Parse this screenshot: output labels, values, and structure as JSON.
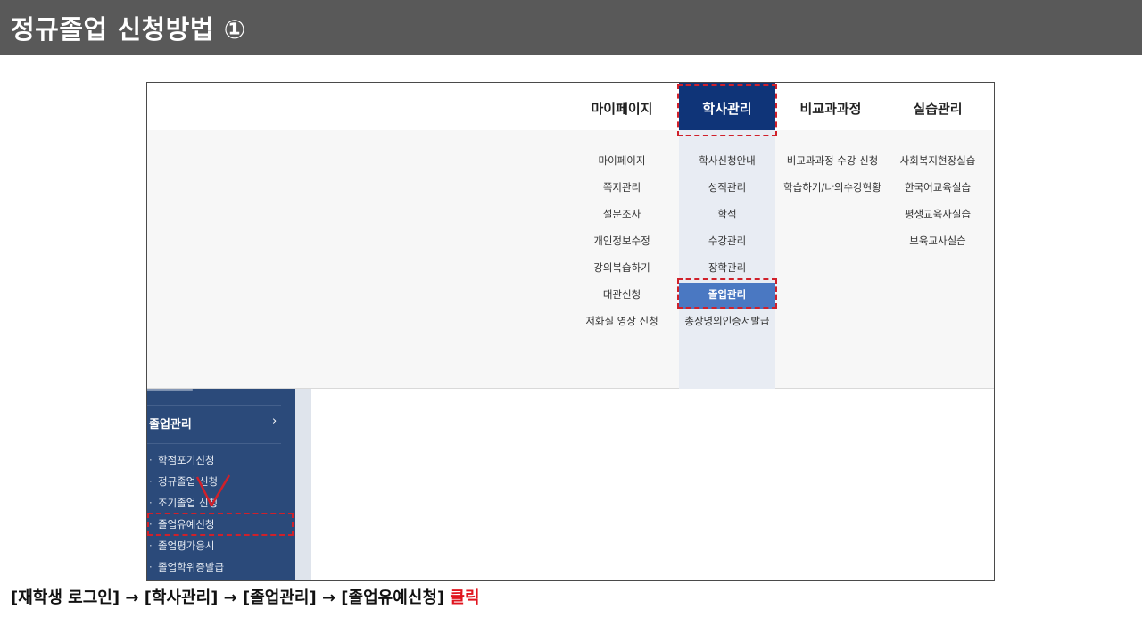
{
  "slide": {
    "title": "정규졸업 신청방법 ①",
    "instruction": "[재학생 로그인] → [학사관리] → [졸업관리] → [졸업유예신청]",
    "instruction_emphasis": "클릭",
    "emphasis_color": "#e0151f",
    "highlight_color": "#d0202a"
  },
  "menu": {
    "top_items": [
      {
        "label": "마이페이지",
        "active": false
      },
      {
        "label": "학사관리",
        "active": true
      },
      {
        "label": "비교과과정",
        "active": false
      },
      {
        "label": "실습관리",
        "active": false
      }
    ],
    "columns": [
      {
        "items": [
          "마이페이지",
          "쪽지관리",
          "설문조사",
          "개인정보수정",
          "강의복습하기",
          "대관신청",
          "저화질 영상 신청"
        ]
      },
      {
        "items": [
          "학사신청안내",
          "성적관리",
          "학적",
          "수강관리",
          "장학관리",
          "졸업관리",
          "총장명의인증서발급"
        ],
        "selected_index": 5
      },
      {
        "items": [
          "비교과과정 수강 신청",
          "학습하기/나의수강현황"
        ]
      },
      {
        "items": [
          "사회복지현장실습",
          "한국어교육실습",
          "평생교육사실습",
          "보육교사실습"
        ]
      }
    ],
    "active_color": "#0f3478",
    "selected_item_color": "#4a78c2"
  },
  "sidebar": {
    "group_label": "졸업관리",
    "chevron": "›",
    "items": [
      "학점포기신청",
      "정규졸업 신청",
      "조기졸업 신청",
      "졸업유예신청",
      "졸업평가응시",
      "졸업학위증발급"
    ],
    "highlighted_index": 3,
    "background_color": "#2b4a7a"
  }
}
